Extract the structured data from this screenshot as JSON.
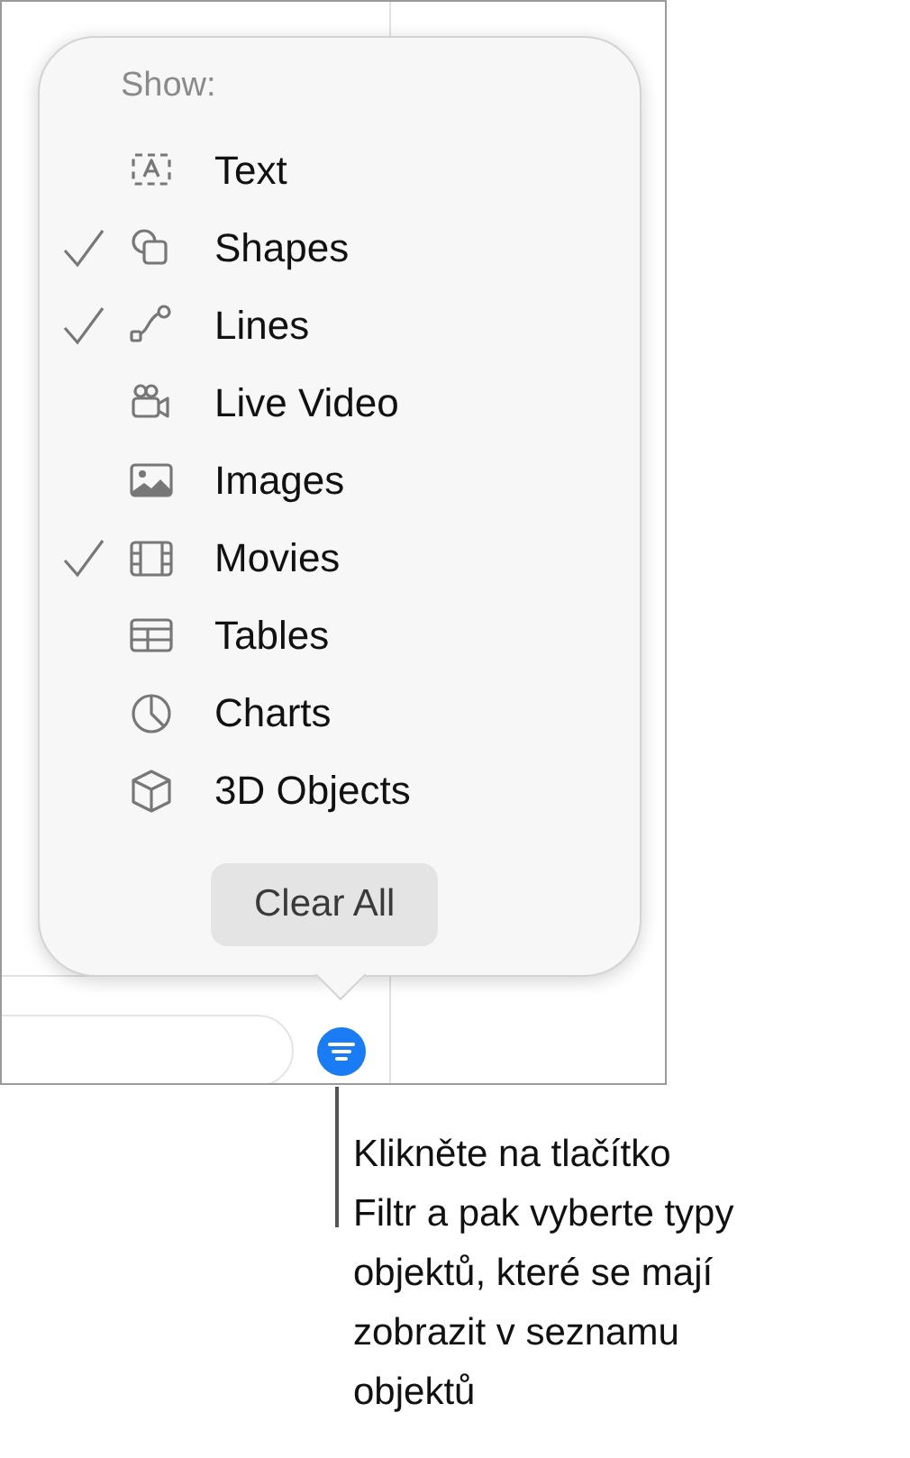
{
  "popover": {
    "heading": "Show:",
    "items": [
      {
        "label": "Text",
        "checked": false
      },
      {
        "label": "Shapes",
        "checked": true
      },
      {
        "label": "Lines",
        "checked": true
      },
      {
        "label": "Live Video",
        "checked": false
      },
      {
        "label": "Images",
        "checked": false
      },
      {
        "label": "Movies",
        "checked": true
      },
      {
        "label": "Tables",
        "checked": false
      },
      {
        "label": "Charts",
        "checked": false
      },
      {
        "label": "3D Objects",
        "checked": false
      }
    ],
    "clear_button": "Clear All"
  },
  "callout": {
    "lines": [
      "Klikněte na tlačítko",
      "Filtr a pak vyberte typy",
      "objektů, které se mají",
      "zobrazit v seznamu",
      "objektů"
    ]
  }
}
